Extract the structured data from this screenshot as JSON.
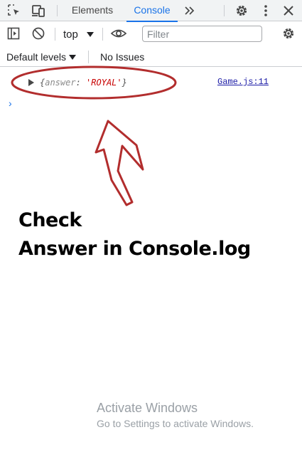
{
  "tabbar": {
    "tabs": [
      {
        "label": "Elements",
        "active": false
      },
      {
        "label": "Console",
        "active": true
      }
    ],
    "more_tabs_glyph": "»",
    "icons": [
      "inspect-element-icon",
      "device-toggle-icon",
      "chevrons-right-icon",
      "settings-gear-icon",
      "more-vertical-icon",
      "close-icon"
    ]
  },
  "toolbar": {
    "context": "top",
    "filter_placeholder": "Filter",
    "icons": [
      "sidebar-toggle-icon",
      "clear-console-icon",
      "dropdown-caret-icon",
      "live-expression-eye-icon",
      "console-settings-gear-icon"
    ]
  },
  "levels": {
    "label": "Default levels",
    "issues": "No Issues"
  },
  "console": {
    "messages": [
      {
        "brace_open": "{",
        "key": "answer",
        "colon": ": ",
        "value": "'ROYAL'",
        "brace_close": "}",
        "source": "Game.js:11"
      }
    ],
    "prompt_glyph": "›"
  },
  "annotation": {
    "line1": "Check",
    "line2": "Answer in Console.log",
    "color": "#b22d2d"
  },
  "watermark": {
    "line1": "Activate Windows",
    "line2": "Go to Settings to activate Windows."
  },
  "colors": {
    "accent": "#1a73e8",
    "string_value": "#c80000",
    "link": "#1a1aa6"
  }
}
